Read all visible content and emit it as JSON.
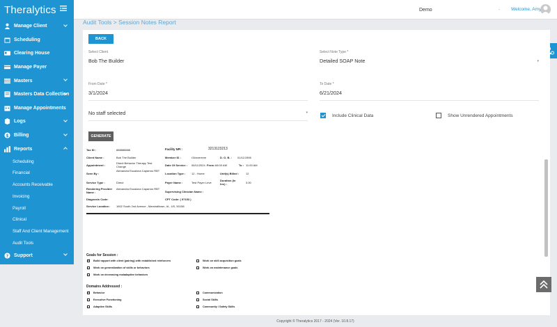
{
  "brand": {
    "logo": "Theralytics"
  },
  "sidebar": {
    "items": [
      {
        "label": "Manage Client",
        "icon": "user-icon",
        "chevron": true
      },
      {
        "label": "Scheduling",
        "icon": "calendar-icon",
        "chevron": false
      },
      {
        "label": "Clearing House",
        "icon": "card-icon",
        "chevron": false
      },
      {
        "label": "Manage Payer",
        "icon": "payer-icon",
        "chevron": false
      },
      {
        "label": "Masters",
        "icon": "masters-icon",
        "chevron": true
      },
      {
        "label": "Masters Data Collection",
        "icon": "collection-icon",
        "chevron": true
      },
      {
        "label": "Manage Appointments",
        "icon": "appointments-icon",
        "chevron": false
      },
      {
        "label": "Logs",
        "icon": "logs-icon",
        "chevron": true
      },
      {
        "label": "Billing",
        "icon": "billing-icon",
        "chevron": true
      },
      {
        "label": "Reports",
        "icon": "reports-icon",
        "chevron": true
      }
    ],
    "report_sub_items": [
      "Scheduling",
      "Financial",
      "Accounts Receivable",
      "Invoicing",
      "Payroll",
      "Clinical",
      "Staff And Client Management",
      "Audit Tools"
    ],
    "support": {
      "label": "Support",
      "icon": "support-icon"
    }
  },
  "topbar": {
    "org": "Demo",
    "dots": "-",
    "welcome": "Welcome, Amy"
  },
  "breadcrumb": "Audit Tools > Session Notes Report",
  "form": {
    "back_label": "BACK",
    "client_label": "Select Client",
    "client_value": "Bob The Builder",
    "note_type_label": "Select Note Type *",
    "note_type_value": "Detailed SOAP Note",
    "from_label": "From Date *",
    "from_value": "3/1/2024",
    "to_label": "To Date *",
    "to_value": "6/21/2024",
    "staff_value": "No staff selected",
    "include_clinical_label": "Include Clinical Data",
    "show_unrendered_label": "Show Unrendered Appointments",
    "generate_label": "GENERATE"
  },
  "report": {
    "tax_id_label": "Tax ID :",
    "tax_id": "888888888",
    "facility_npi_label": "Facility NPI :",
    "facility_npi": "3213123213",
    "client_name_label": "Client Name :",
    "client_name": "Bob The Builder",
    "member_id_label": "Member ID :",
    "member_id": "r34nverevre",
    "dob_label": "D. O. B. :",
    "dob": "01/11/1998",
    "appointment_label": "Appointment :",
    "appointment": "Direct Behavior Therapy Test Change",
    "dos_label": "Date Of Service :",
    "dos": "06/11/2024",
    "from_label": "From :",
    "from": "08:00 AM",
    "to_label": "To :",
    "to": "11:00 AM",
    "seen_by_label": "Seen By :",
    "seen_by": "Alexandra Escalona Caparros RBT",
    "location_type_label": "Location Type :",
    "location_type": "12 - Home",
    "units_label": "Unit(s) Billed :",
    "units": "12",
    "service_type_label": "Service Type :",
    "service_type": "Direct",
    "payer_label": "Payer Name :",
    "payer": "Test Payer Leve",
    "duration_label": "Duration (In hrs) :",
    "duration": "3.00",
    "rendering_label": "Rendering Provider Name :",
    "rendering": "Alexandra Escalona Caparros RBT",
    "supervising_label": "Supervising Clinician Name :",
    "diagnosis_label": "Diagnosis Code:",
    "cpt_label": "CPT Code: ( 97153 )",
    "service_location_label": "Service Location :",
    "service_location": "1602 South 2nd Avenue , Marshalltown, IA , US, 50158",
    "goals_title": "Goals for Session :",
    "goals": [
      {
        "label": "Build rapport with client (pairing) with established reinforcers",
        "checked": true
      },
      {
        "label": "Work on skill acquisition goals",
        "checked": false
      },
      {
        "label": "Work on generalization of skills or behaviors",
        "checked": false
      },
      {
        "label": "Work on maintenance goals",
        "checked": false
      },
      {
        "label": "Work on decreasing maladaptive behaviors",
        "checked": false
      }
    ],
    "domains_title": "Domains Addressed :",
    "domains": [
      {
        "label": "Behavior",
        "checked": true
      },
      {
        "label": "Communication",
        "checked": false
      },
      {
        "label": "Executive Functioning",
        "checked": false
      },
      {
        "label": "Social Skills",
        "checked": false
      },
      {
        "label": "Adaptive Skills",
        "checked": false
      },
      {
        "label": "Community / Safety Skills",
        "checked": false
      }
    ]
  },
  "footer": "Copyright © Theralytics 2017 - 2024 (Ver. 10.8.17)",
  "colors": {
    "primary": "#1f94d2",
    "generate": "#5f5f5f",
    "background": "#e9ebee"
  }
}
